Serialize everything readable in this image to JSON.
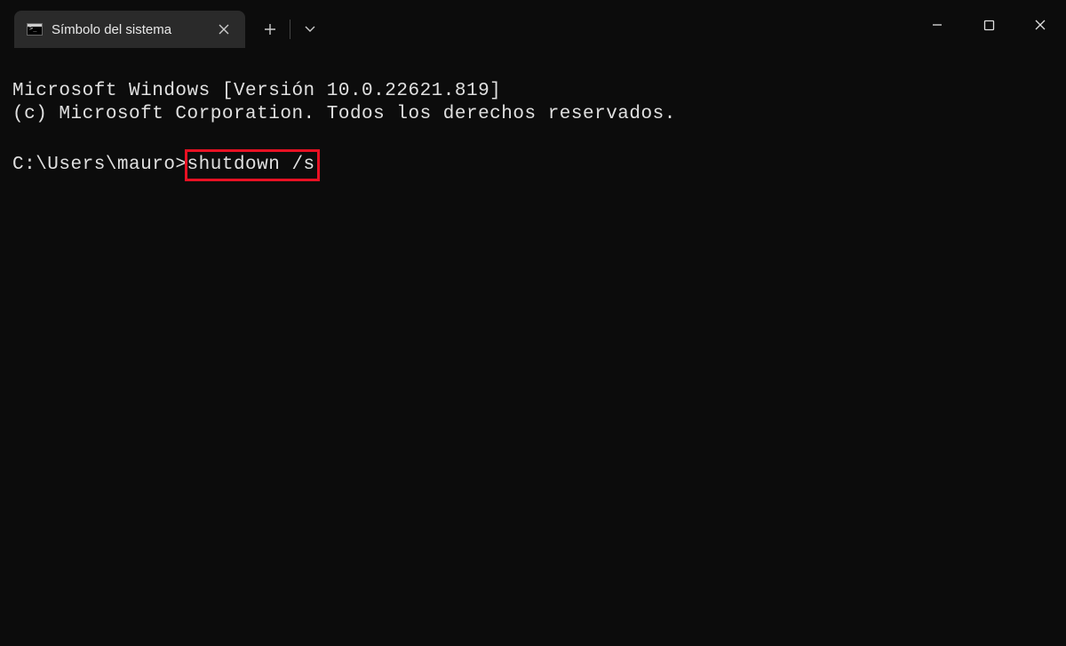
{
  "window": {
    "tab_title": "Símbolo del sistema",
    "minimize_name": "minimize",
    "maximize_name": "maximize",
    "close_name": "close"
  },
  "terminal": {
    "line1": "Microsoft Windows [Versión 10.0.22621.819]",
    "line2": "(c) Microsoft Corporation. Todos los derechos reservados.",
    "prompt": "C:\\Users\\mauro>",
    "command": "shutdown /s"
  }
}
